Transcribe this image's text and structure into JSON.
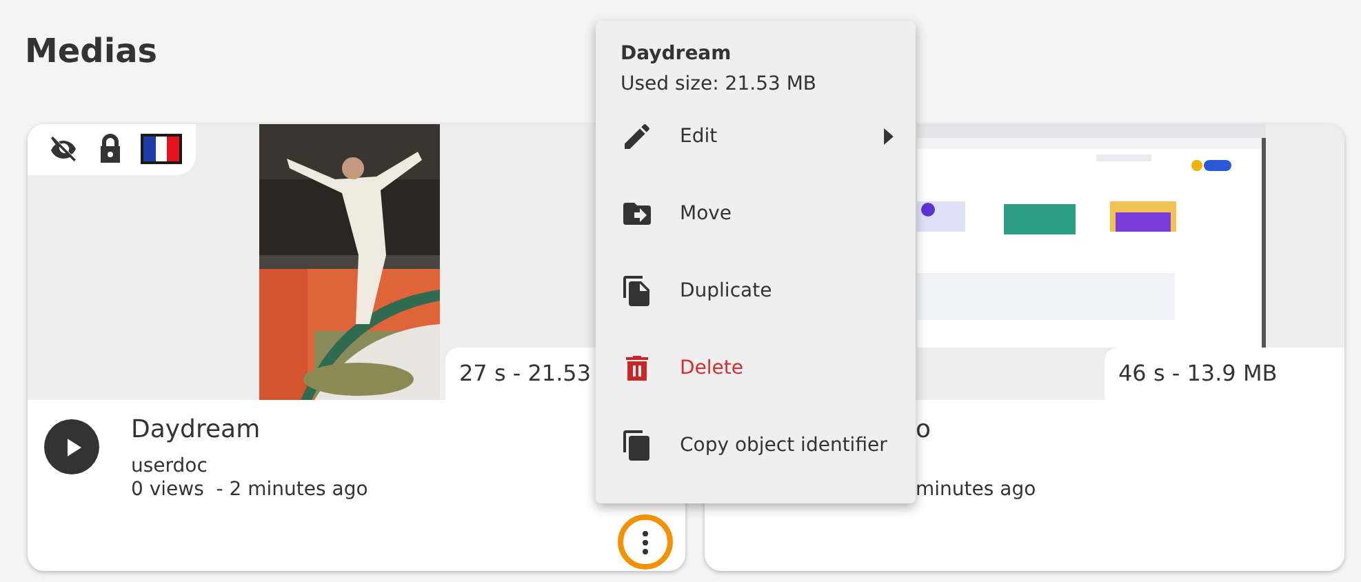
{
  "page_title": "Medias",
  "cards": [
    {
      "kind": "full",
      "title": "Daydream",
      "author": "userdoc",
      "meta": "0 views  - 2 minutes ago",
      "duration_size": "27 s - 21.53",
      "highlighted": true
    },
    {
      "kind": "partly_covered",
      "title": "o",
      "meta": "minutes ago",
      "duration_size": "46 s - 13.9 MB"
    }
  ],
  "menu": {
    "title": "Daydream",
    "subtitle": "Used size: 21.53 MB",
    "items": [
      {
        "kind": "edit",
        "label": "Edit",
        "submenu": true,
        "danger": false
      },
      {
        "kind": "move",
        "label": "Move",
        "submenu": false,
        "danger": false
      },
      {
        "kind": "duplicate",
        "label": "Duplicate",
        "submenu": false,
        "danger": false
      },
      {
        "kind": "delete",
        "label": "Delete",
        "submenu": false,
        "danger": true
      },
      {
        "kind": "copy_id",
        "label": "Copy object identifier",
        "submenu": false,
        "danger": false
      }
    ]
  }
}
